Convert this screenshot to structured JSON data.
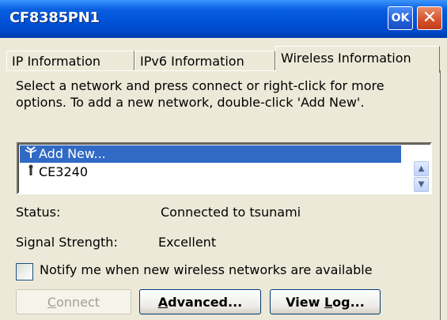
{
  "window": {
    "title": "CF8385PN1",
    "ok_label": "OK",
    "close_label": "✕"
  },
  "tabs": [
    {
      "label": "IP Information",
      "active": false
    },
    {
      "label": "IPv6 Information",
      "active": false
    },
    {
      "label": "Wireless Information",
      "active": true
    }
  ],
  "instructions": "Select a network and press connect or right-click for more options.  To add a new network, double-click 'Add New'.",
  "networks": [
    {
      "label": "Add New...",
      "icon": "antenna-icon",
      "selected": true
    },
    {
      "label": "CE3240",
      "icon": "adhoc-icon",
      "selected": false
    }
  ],
  "status": {
    "label": "Status:",
    "value": "Connected to tsunami"
  },
  "signal": {
    "label": "Signal Strength:",
    "value": "Excellent"
  },
  "notify": {
    "label": "Notify me when new wireless networks are available",
    "checked": false
  },
  "buttons": {
    "connect": {
      "prefix": "",
      "underline": "C",
      "rest": "onnect",
      "enabled": false
    },
    "advanced": {
      "prefix": "",
      "underline": "A",
      "rest": "dvanced...",
      "enabled": true
    },
    "view_log": {
      "prefix": "View ",
      "underline": "L",
      "rest": "og...",
      "enabled": true
    }
  },
  "colors": {
    "titlebar": "#0052D6",
    "selection": "#316AC5",
    "face": "#ECE9D8"
  }
}
